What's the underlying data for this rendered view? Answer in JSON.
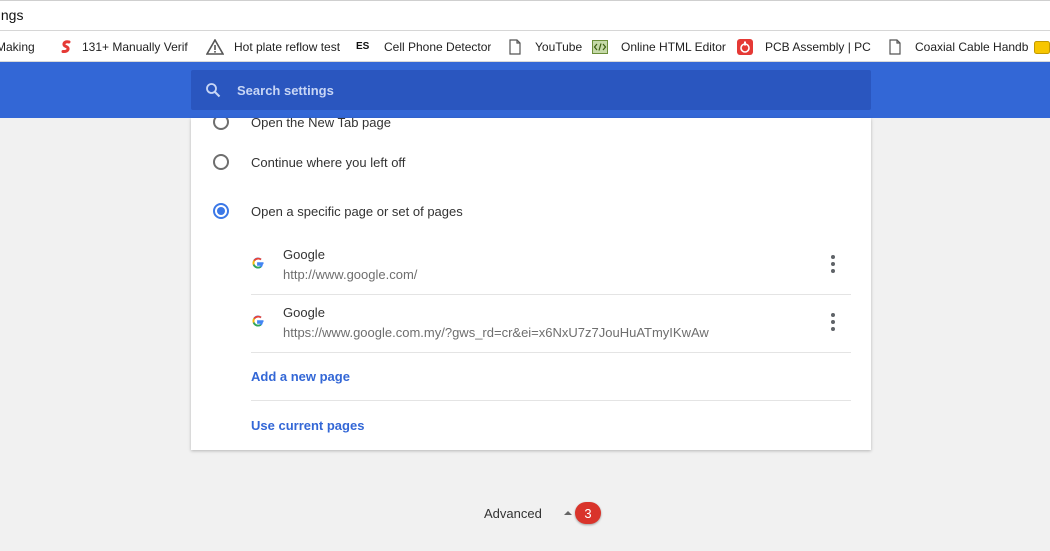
{
  "address_bar": {
    "url": "ttings"
  },
  "bookmarks": [
    {
      "label": "Making",
      "icon": "bookmark-page-icon"
    },
    {
      "label": "131+ Manually Verif",
      "icon": "s-logo-icon",
      "color": "#e53935"
    },
    {
      "label": "Hot plate reflow test",
      "icon": "warning-triangle-icon"
    },
    {
      "label": "Cell Phone Detector",
      "icon": "es-logo-icon"
    },
    {
      "label": "YouTube",
      "icon": "page-icon"
    },
    {
      "label": "Online HTML Editor",
      "icon": "code-editor-icon"
    },
    {
      "label": "PCB Assembly | PCB",
      "icon": "pcb-logo-icon",
      "color": "#e53935"
    },
    {
      "label": "Coaxial Cable Handb",
      "icon": "page-icon"
    }
  ],
  "search": {
    "placeholder": "Search settings"
  },
  "startup": {
    "options": [
      {
        "label": "Open the New Tab page",
        "checked": false
      },
      {
        "label": "Continue where you left off",
        "checked": false
      },
      {
        "label": "Open a specific page or set of pages",
        "checked": true
      }
    ],
    "pages": [
      {
        "name": "Google",
        "url": "http://www.google.com/"
      },
      {
        "name": "Google",
        "url": "https://www.google.com.my/?gws_rd=cr&ei=x6NxU7z7JouHuATmyIKwAw"
      }
    ],
    "add_page": "Add a new page",
    "use_current": "Use current pages"
  },
  "advanced": {
    "label": "Advanced",
    "badge": "3"
  },
  "colors": {
    "header": "#3367d6",
    "accent": "#3b78e7",
    "badge": "#d9342b"
  }
}
